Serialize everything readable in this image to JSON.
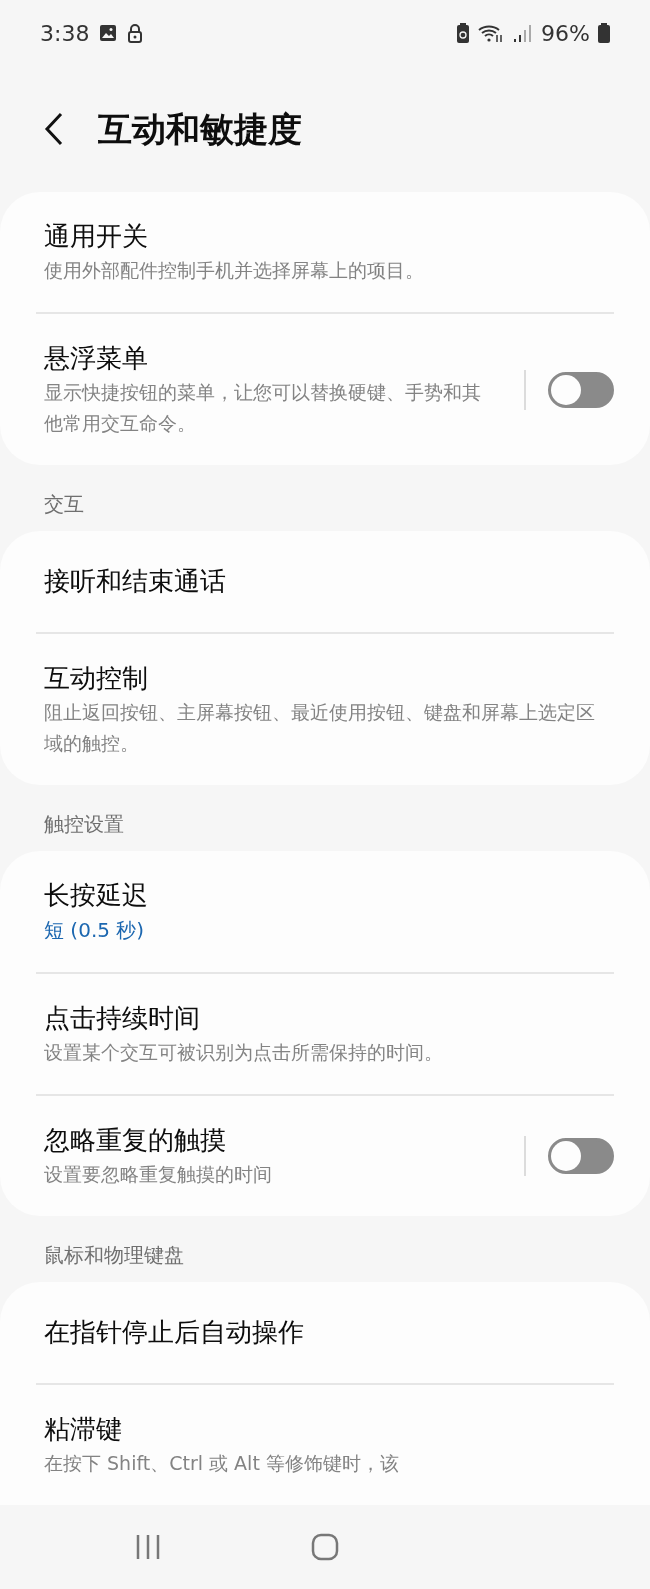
{
  "status_bar": {
    "time": "3:38",
    "battery": "96%"
  },
  "header": {
    "title": "互动和敏捷度"
  },
  "sections": [
    {
      "items": [
        {
          "kind": "plain",
          "title": "通用开关",
          "subtitle": "使用外部配件控制手机并选择屏幕上的项目。"
        },
        {
          "kind": "toggle",
          "title": "悬浮菜单",
          "subtitle": "显示快捷按钮的菜单，让您可以替换硬键、手势和其他常用交互命令。",
          "on": false
        }
      ]
    },
    {
      "label": "交互",
      "items": [
        {
          "kind": "plain",
          "title": "接听和结束通话"
        },
        {
          "kind": "plain",
          "title": "互动控制",
          "subtitle": "阻止返回按钮、主屏幕按钮、最近使用按钮、键盘和屏幕上选定区域的触控。"
        }
      ]
    },
    {
      "label": "触控设置",
      "items": [
        {
          "kind": "plain",
          "title": "长按延迟",
          "value": "短 (0.5 秒)"
        },
        {
          "kind": "plain",
          "title": "点击持续时间",
          "subtitle": "设置某个交互可被识别为点击所需保持的时间。"
        },
        {
          "kind": "toggle",
          "title": "忽略重复的触摸",
          "subtitle": "设置要忽略重复触摸的时间",
          "on": false
        }
      ]
    },
    {
      "label": "鼠标和物理键盘",
      "items": [
        {
          "kind": "plain",
          "title": "在指针停止后自动操作"
        },
        {
          "kind": "plain",
          "title": "粘滞键",
          "subtitle": "在按下 Shift、Ctrl 或 Alt 等修饰键时，该"
        }
      ]
    }
  ]
}
